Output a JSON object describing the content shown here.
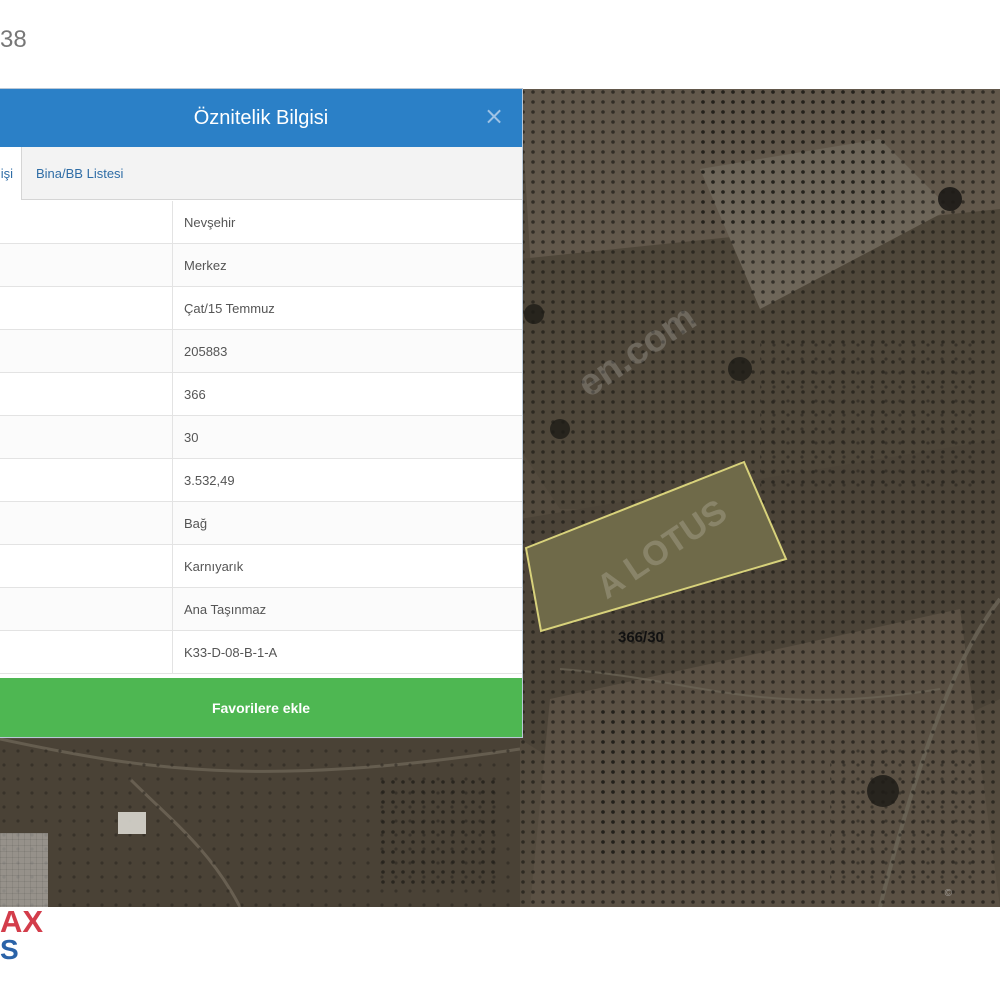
{
  "top_bar": {
    "partial_text": "38"
  },
  "panel": {
    "title": "Öznitelik Bilgisi",
    "close_symbol": "×",
    "tabs": [
      {
        "label": "işi",
        "active": true
      },
      {
        "label": "Bina/BB Listesi",
        "active": false
      }
    ],
    "rows": [
      {
        "value": "Nevşehir"
      },
      {
        "value": "Merkez"
      },
      {
        "value": "Çat/15 Temmuz"
      },
      {
        "value": "205883"
      },
      {
        "value": "366"
      },
      {
        "value": "30"
      },
      {
        "value": "3.532,49"
      },
      {
        "value": "Bağ"
      },
      {
        "value": "Karnıyarık"
      },
      {
        "value": "Ana Taşınmaz"
      },
      {
        "value": "K33-D-08-B-1-A"
      }
    ],
    "favorite_button_label": "Favorilere ekle"
  },
  "map": {
    "parcel_label": "366/30",
    "watermarks": [
      "en.com",
      "A LOTUS"
    ]
  },
  "branding": {
    "max_text": "AX",
    "s_text": "S"
  },
  "colors": {
    "header_blue": "#2b80c7",
    "button_green": "#4eb752",
    "parcel_outline": "#d8d27b",
    "logo_red": "#d33d4b",
    "logo_blue": "#2b63a8"
  }
}
